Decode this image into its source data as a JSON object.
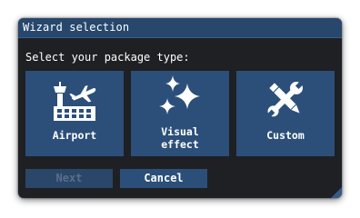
{
  "window": {
    "title": "Wizard selection"
  },
  "prompt": "Select your package type:",
  "options": [
    {
      "label": "Airport",
      "icon": "airport-icon"
    },
    {
      "label": "Visual\neffect",
      "icon": "sparkles-icon"
    },
    {
      "label": "Custom",
      "icon": "tools-icon"
    }
  ],
  "buttons": {
    "next_label": "Next",
    "next_enabled": false,
    "cancel_label": "Cancel"
  },
  "colors": {
    "dialog_bg": "#1f2023",
    "titlebar": "#27476c",
    "tile": "#2c4f7a",
    "text": "#ffffff",
    "disabled_text": "#5a6f8a"
  }
}
